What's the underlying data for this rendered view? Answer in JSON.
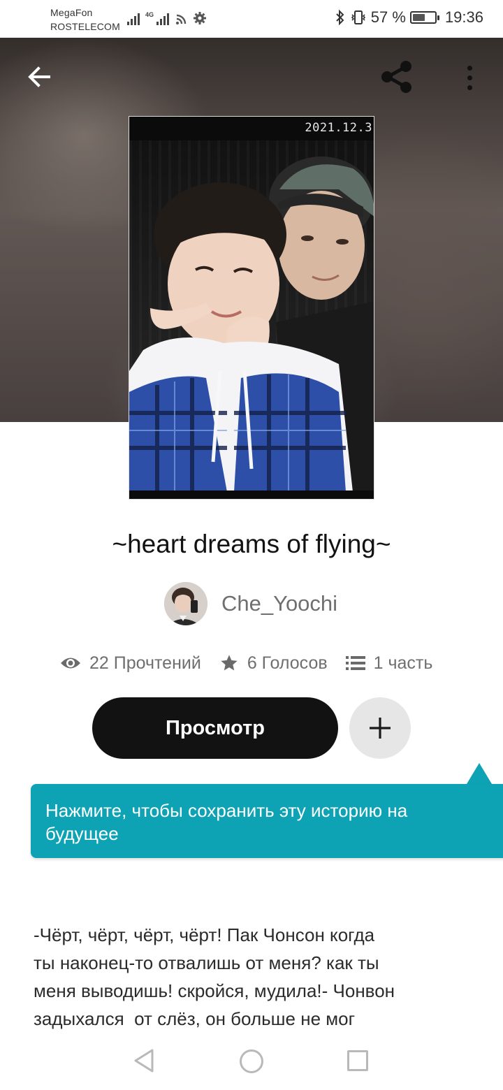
{
  "status_bar": {
    "carrier_1": "MegaFon",
    "carrier_2": "ROSTELECOM",
    "network_type": "4G",
    "battery": "57 %",
    "battery_level": 0.57,
    "time": "19:36",
    "icons": [
      "signal-icon",
      "wifi-icon",
      "settings-icon",
      "bluetooth-icon",
      "vibrate-icon",
      "battery-icon"
    ]
  },
  "header": {
    "back_icon": "arrow-left-icon",
    "share_icon": "share-icon",
    "more_icon": "more-vertical-icon"
  },
  "cover": {
    "date_stamp": "2021.12.3"
  },
  "story": {
    "title": "~heart dreams of flying~",
    "author": "Che_Yoochi",
    "stats": {
      "reads": "22 Прочтений",
      "votes": "6 Голосов",
      "parts": "1 часть"
    },
    "read_button": "Просмотр",
    "add_button_icon": "plus-icon",
    "tooltip": "Нажмите, чтобы сохранить эту историю на будущее",
    "excerpt": "-Чёрт, чёрт, чёрт, чёрт! Пак Чонсон когда\nты наконец-то отвалишь от меня? как ты\nменя выводишь! скройся, мудила!- Чонвон\nзадыхался  от слёз, он больше не мог"
  },
  "colors": {
    "accent": "#0ea3b4",
    "primary_button": "#121212",
    "secondary_text": "#6f6f6f"
  }
}
